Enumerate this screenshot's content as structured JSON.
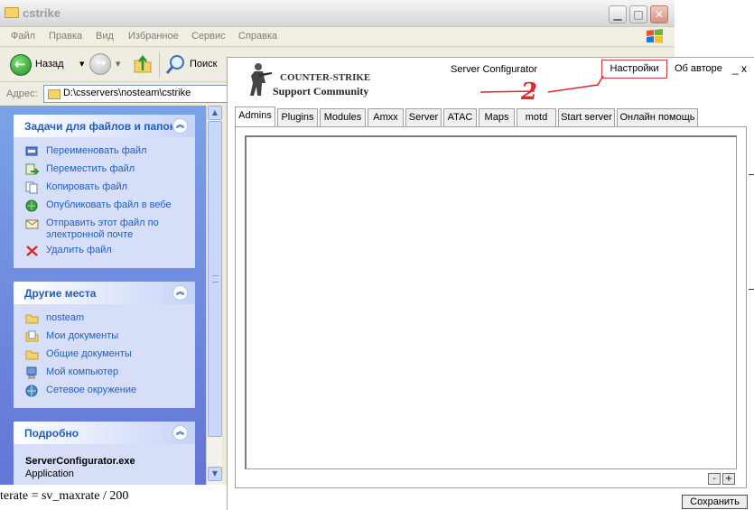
{
  "explorer": {
    "title": "cstrike",
    "menu": [
      "Файл",
      "Правка",
      "Вид",
      "Избранное",
      "Сервис",
      "Справка"
    ],
    "toolbar": {
      "back_label": "Назад",
      "search_label": "Поиск"
    },
    "address": {
      "label": "Адрес:",
      "value": "D:\\csservers\\nosteam\\cstrike"
    },
    "tasks_panel": {
      "title": "Задачи для файлов и папок",
      "items": [
        {
          "label": "Переименовать файл",
          "icon": "rename-icon"
        },
        {
          "label": "Переместить файл",
          "icon": "move-icon"
        },
        {
          "label": "Копировать файл",
          "icon": "copy-icon"
        },
        {
          "label": "Опубликовать файл в вебе",
          "icon": "publish-web-icon"
        },
        {
          "label": "Отправить этот файл по электронной почте",
          "icon": "email-icon"
        },
        {
          "label": "Удалить файл",
          "icon": "delete-icon"
        }
      ]
    },
    "places_panel": {
      "title": "Другие места",
      "items": [
        {
          "label": "nosteam",
          "icon": "folder-icon"
        },
        {
          "label": "Мои документы",
          "icon": "my-documents-icon"
        },
        {
          "label": "Общие документы",
          "icon": "shared-documents-icon"
        },
        {
          "label": "Мой компьютер",
          "icon": "my-computer-icon"
        },
        {
          "label": "Сетевое окружение",
          "icon": "network-icon"
        }
      ]
    },
    "details_panel": {
      "title": "Подробно",
      "file_name": "ServerConfigurator.exe",
      "file_type": "Application"
    }
  },
  "background_text": "terate = sv_maxrate / 200",
  "configurator": {
    "logo_title": "COUNTER-STRIKE",
    "logo_subtitle": "Support Community",
    "title": "Server Configurator",
    "settings_link": "Настройки",
    "about_link": "Об авторе",
    "minimize_link": "_",
    "close_link": "x",
    "annotation": "2",
    "tabs": [
      "Admins",
      "Plugins",
      "Modules",
      "Amxx",
      "Server",
      "ATAC",
      "Maps",
      "motd",
      "Start server",
      "Онлайн помощь"
    ],
    "active_tab": "Admins",
    "minus_label": "-",
    "plus_label": "+",
    "save_label": "Сохранить"
  },
  "colors": {
    "panel_link": "#215dc6",
    "annotation": "#e32626",
    "settings_border": "#d43c3c"
  }
}
